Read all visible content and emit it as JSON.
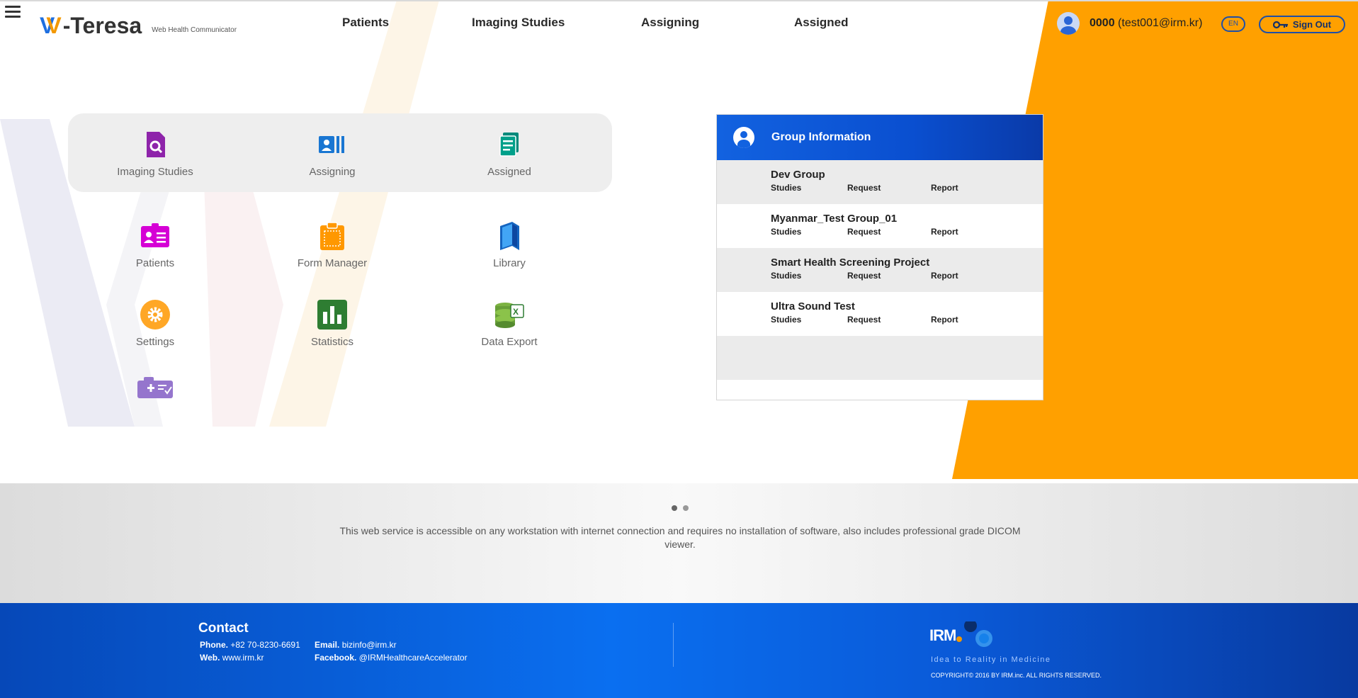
{
  "header": {
    "logo_name": "-Teresa",
    "logo_sub": "Web Health Communicator",
    "nav": [
      "Patients",
      "Imaging Studies",
      "Assigning",
      "Assigned"
    ],
    "user_id": "0000",
    "user_email": "(test001@irm.kr)",
    "lang": "EN",
    "signout": "Sign Out"
  },
  "menu": {
    "top": [
      "Imaging Studies",
      "Assigning",
      "Assigned"
    ],
    "row2": [
      "Patients",
      "Form Manager",
      "Library"
    ],
    "row3": [
      "Settings",
      "Statistics",
      "Data Export"
    ],
    "row4_icon": "medical-kit-check-icon"
  },
  "group": {
    "title": "Group Information",
    "link_labels": {
      "studies": "Studies",
      "request": "Request",
      "report": "Report"
    },
    "rows": [
      {
        "name": "Dev Group"
      },
      {
        "name": "Myanmar_Test Group_01"
      },
      {
        "name": "Smart Health Screening Project"
      },
      {
        "name": "Ultra Sound Test"
      }
    ]
  },
  "band": {
    "text": "This web service is accessible on any workstation with internet connection and requires no installation of software, also includes professional grade DICOM viewer."
  },
  "footer": {
    "contact_title": "Contact",
    "phone_label": "Phone.",
    "phone": "+82 70-8230-6691",
    "email_label": "Email.",
    "email": "bizinfo@irm.kr",
    "web_label": "Web.",
    "web": "www.irm.kr",
    "facebook_label": "Facebook.",
    "facebook": "@IRMHealthcareAccelerator",
    "irm": "IRM",
    "tagline": "Idea to Reality in Medicine",
    "copyright": "COPYRIGHT© 2016 BY IRM.inc. ALL RIGHTS RESERVED."
  },
  "colors": {
    "accent_orange": "#ffa000",
    "brand_blue": "#1262e0",
    "footer_blue": "#0a6ff0"
  }
}
